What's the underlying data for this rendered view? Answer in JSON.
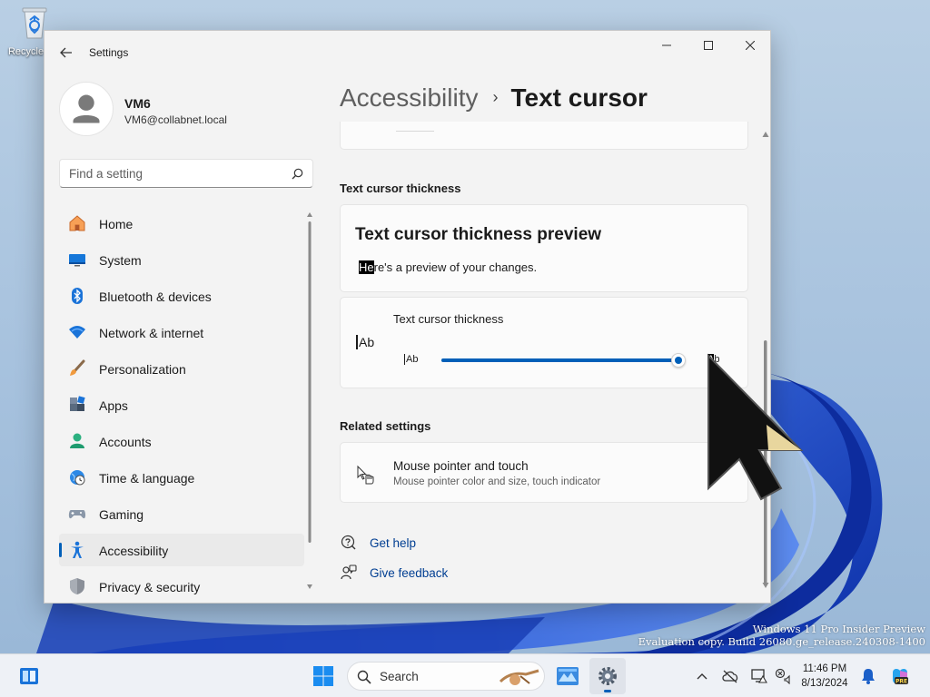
{
  "desktop": {
    "recycle_bin_label": "Recycle Bin",
    "watermark_line1": "Windows 11 Pro Insider Preview",
    "watermark_line2": "Evaluation copy. Build 26080.ge_release.240308-1400"
  },
  "window": {
    "app_title": "Settings",
    "profile": {
      "name": "VM6",
      "email": "VM6@collabnet.local"
    },
    "search": {
      "placeholder": "Find a setting",
      "value": ""
    },
    "nav": [
      {
        "label": "Home",
        "icon": "home-icon",
        "selected": false
      },
      {
        "label": "System",
        "icon": "system-icon",
        "selected": false
      },
      {
        "label": "Bluetooth & devices",
        "icon": "bluetooth-icon",
        "selected": false
      },
      {
        "label": "Network & internet",
        "icon": "wifi-icon",
        "selected": false
      },
      {
        "label": "Personalization",
        "icon": "brush-icon",
        "selected": false
      },
      {
        "label": "Apps",
        "icon": "apps-icon",
        "selected": false
      },
      {
        "label": "Accounts",
        "icon": "accounts-icon",
        "selected": false
      },
      {
        "label": "Time & language",
        "icon": "globe-clock-icon",
        "selected": false
      },
      {
        "label": "Gaming",
        "icon": "gamepad-icon",
        "selected": false
      },
      {
        "label": "Accessibility",
        "icon": "accessibility-icon",
        "selected": true
      },
      {
        "label": "Privacy & security",
        "icon": "shield-icon",
        "selected": false
      }
    ],
    "breadcrumb": {
      "parent": "Accessibility",
      "separator": "›",
      "current": "Text cursor"
    }
  },
  "main": {
    "thickness_section_title": "Text cursor thickness",
    "preview": {
      "title": "Text cursor thickness preview",
      "text_highlight": "He",
      "text_rest": "re's a preview of your changes."
    },
    "slider": {
      "label": "Text cursor thickness",
      "big_sample": "Ab",
      "min_sample": "Ab",
      "max_sample": "Ab",
      "value_fraction": 1.0
    },
    "related_title": "Related settings",
    "related": {
      "title": "Mouse pointer and touch",
      "subtitle": "Mouse pointer color and size, touch indicator"
    },
    "links": {
      "get_help": "Get help",
      "give_feedback": "Give feedback"
    }
  },
  "taskbar": {
    "search_label": "Search",
    "clock_time": "11:46 PM",
    "clock_date": "8/13/2024",
    "accent_color": "#005fb8"
  }
}
